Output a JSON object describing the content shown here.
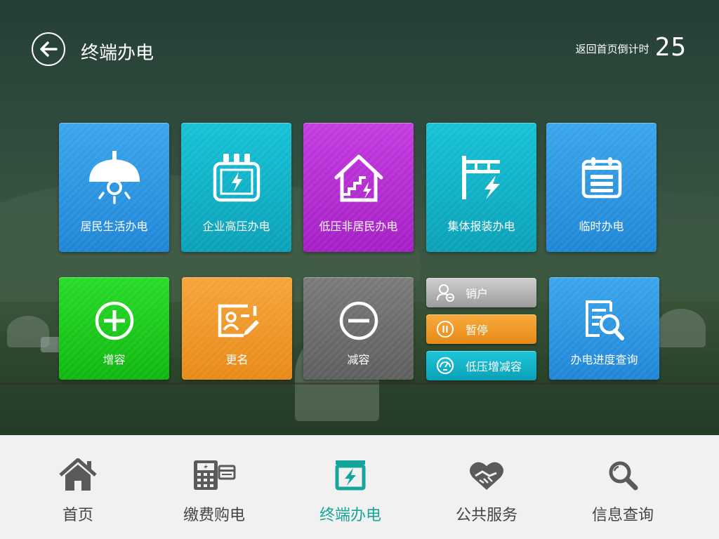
{
  "header": {
    "title": "终端办电",
    "countdown_label": "返回首页倒计时",
    "countdown_value": "25"
  },
  "tiles": [
    {
      "label": "居民生活办电",
      "color": "#2f9ae3",
      "icon": "lamp-icon"
    },
    {
      "label": "企业高压办电",
      "color": "#10b3c8",
      "icon": "transformer-icon"
    },
    {
      "label": "低压非居民办电",
      "color": "#b82fd4",
      "icon": "house-stairs-bolt-icon"
    },
    {
      "label": "集体报装办电",
      "color": "#10b3c8",
      "icon": "power-pole-bolt-icon"
    },
    {
      "label": "临时办电",
      "color": "#2f9ae3",
      "icon": "calendar-list-icon"
    },
    {
      "label": "增容",
      "color": "#1ccb1c",
      "icon": "plus-circle-icon"
    },
    {
      "label": "更名",
      "color": "#ef981f",
      "icon": "id-card-edit-icon"
    },
    {
      "label": "减容",
      "color": "#6b6b6b",
      "icon": "minus-circle-icon"
    },
    {
      "label": "办电进度查询",
      "color": "#2f9ae3",
      "icon": "document-search-icon"
    }
  ],
  "mini_buttons": [
    {
      "label": "销户",
      "color": "#b5b5b5",
      "icon": "user-remove-icon"
    },
    {
      "label": "暂停",
      "color": "#ef981f",
      "icon": "pause-icon"
    },
    {
      "label": "低压增减容",
      "color": "#10b3c8",
      "icon": "gauge-icon"
    }
  ],
  "nav": [
    {
      "label": "首页",
      "icon": "home-icon",
      "active": false
    },
    {
      "label": "缴费购电",
      "icon": "card-payment-icon",
      "active": false
    },
    {
      "label": "终端办电",
      "icon": "terminal-bolt-icon",
      "active": true
    },
    {
      "label": "公共服务",
      "icon": "heart-handshake-icon",
      "active": false
    },
    {
      "label": "信息查询",
      "icon": "magnifier-icon",
      "active": false
    }
  ],
  "colors": {
    "nav_active": "#16a59a",
    "nav_inactive": "#444444",
    "nav_background": "#f1f1f1"
  }
}
